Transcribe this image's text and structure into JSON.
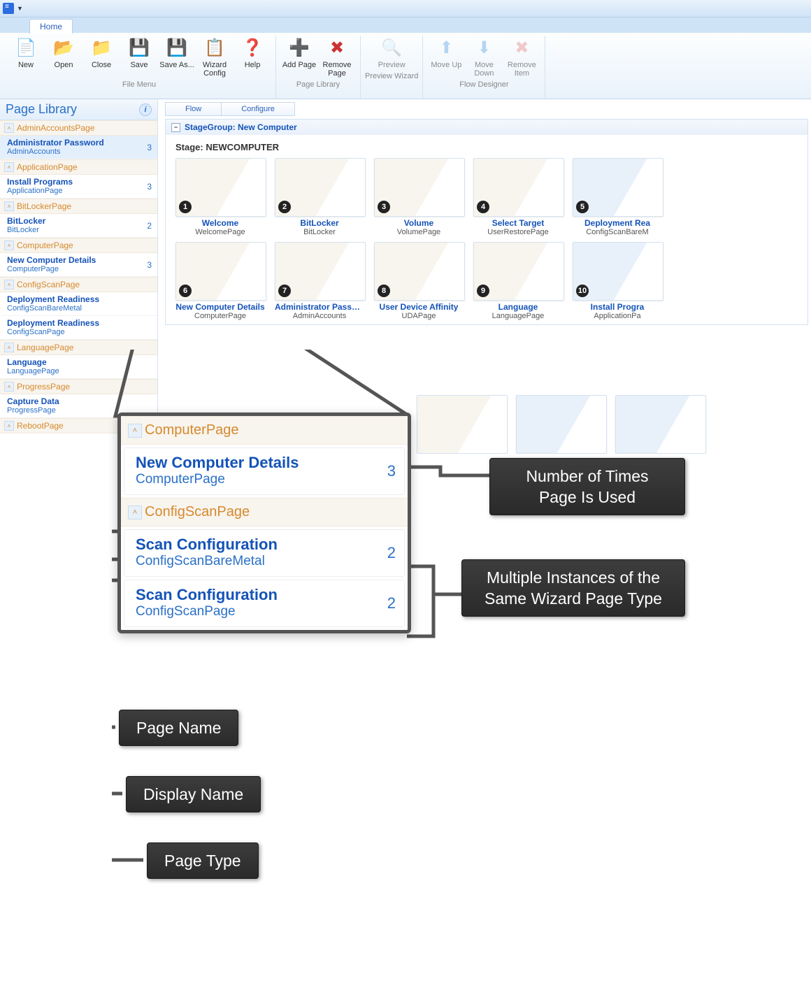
{
  "titlebar": {
    "app_menu_tooltip": "Application Menu"
  },
  "ribbon": {
    "tab": "Home",
    "groups": [
      {
        "label": "File Menu",
        "buttons": [
          {
            "icon": "ic-new",
            "label": "New"
          },
          {
            "icon": "ic-open",
            "label": "Open"
          },
          {
            "icon": "ic-close",
            "label": "Close"
          },
          {
            "icon": "ic-save",
            "label": "Save"
          },
          {
            "icon": "ic-saveas",
            "label": "Save As..."
          },
          {
            "icon": "ic-wizard",
            "label": "Wizard Config"
          },
          {
            "icon": "ic-help",
            "label": "Help"
          }
        ]
      },
      {
        "label": "Page Library",
        "buttons": [
          {
            "icon": "ic-add",
            "label": "Add Page"
          },
          {
            "icon": "ic-remove",
            "label": "Remove Page"
          }
        ]
      },
      {
        "label": "Preview Wizard",
        "buttons": [
          {
            "icon": "ic-preview",
            "label": "Preview",
            "disabled": true
          }
        ]
      },
      {
        "label": "Flow Designer",
        "buttons": [
          {
            "icon": "ic-up",
            "label": "Move Up",
            "disabled": true
          },
          {
            "icon": "ic-down",
            "label": "Move Down",
            "disabled": true
          },
          {
            "icon": "ic-removeitem",
            "label": "Remove Item",
            "disabled": true
          }
        ]
      }
    ]
  },
  "sidebar": {
    "title": "Page Library",
    "groups": [
      {
        "name": "AdminAccountsPage",
        "pages": [
          {
            "title": "Administrator Password",
            "sub": "AdminAccounts",
            "count": 3,
            "selected": true
          }
        ]
      },
      {
        "name": "ApplicationPage",
        "pages": [
          {
            "title": "Install Programs",
            "sub": "ApplicationPage",
            "count": 3
          }
        ]
      },
      {
        "name": "BitLockerPage",
        "pages": [
          {
            "title": "BitLocker",
            "sub": "BitLocker",
            "count": 2
          }
        ]
      },
      {
        "name": "ComputerPage",
        "pages": [
          {
            "title": "New Computer Details",
            "sub": "ComputerPage",
            "count": 3
          }
        ]
      },
      {
        "name": "ConfigScanPage",
        "pages": [
          {
            "title": "Deployment Readiness",
            "sub": "ConfigScanBareMetal",
            "count": ""
          },
          {
            "title": "Deployment Readiness",
            "sub": "ConfigScanPage",
            "count": ""
          }
        ]
      },
      {
        "name": "LanguagePage",
        "pages": [
          {
            "title": "Language",
            "sub": "LanguagePage",
            "count": ""
          }
        ]
      },
      {
        "name": "ProgressPage",
        "pages": [
          {
            "title": "Capture Data",
            "sub": "ProgressPage",
            "count": ""
          }
        ]
      },
      {
        "name": "RebootPage",
        "pages": []
      }
    ]
  },
  "main": {
    "subtabs": [
      "Flow",
      "Configure"
    ],
    "stage_group_label": "StageGroup: New Computer",
    "stage_label": "Stage: NEWCOMPUTER",
    "thumbs_row1": [
      {
        "num": 1,
        "title": "Welcome",
        "sub": "WelcomePage"
      },
      {
        "num": 2,
        "title": "BitLocker",
        "sub": "BitLocker"
      },
      {
        "num": 3,
        "title": "Volume",
        "sub": "VolumePage"
      },
      {
        "num": 4,
        "title": "Select Target",
        "sub": "UserRestorePage"
      },
      {
        "num": 5,
        "title": "Deployment Rea",
        "sub": "ConfigScanBareM",
        "blu": true
      }
    ],
    "thumbs_row2": [
      {
        "num": 6,
        "title": "New Computer Details",
        "sub": "ComputerPage"
      },
      {
        "num": 7,
        "title": "Administrator Passw...",
        "sub": "AdminAccounts"
      },
      {
        "num": 8,
        "title": "User Device Affinity",
        "sub": "UDAPage"
      },
      {
        "num": 9,
        "title": "Language",
        "sub": "LanguagePage"
      },
      {
        "num": 10,
        "title": "Install Progra",
        "sub": "ApplicationPa",
        "blu": true
      }
    ]
  },
  "zoom": {
    "groups": [
      {
        "name": "ComputerPage",
        "pages": [
          {
            "title": "New Computer Details",
            "sub": "ComputerPage",
            "count": 3
          }
        ]
      },
      {
        "name": "ConfigScanPage",
        "pages": [
          {
            "title": "Scan Configuration",
            "sub": "ConfigScanBareMetal",
            "count": 2
          },
          {
            "title": "Scan Configuration",
            "sub": "ConfigScanPage",
            "count": 2
          }
        ]
      }
    ]
  },
  "callouts": {
    "count": "Number of Times\nPage Is Used",
    "multi": "Multiple Instances\nof the Same\nWizard Page Type",
    "page_name": "Page Name",
    "display_name": "Display Name",
    "page_type": "Page Type"
  }
}
